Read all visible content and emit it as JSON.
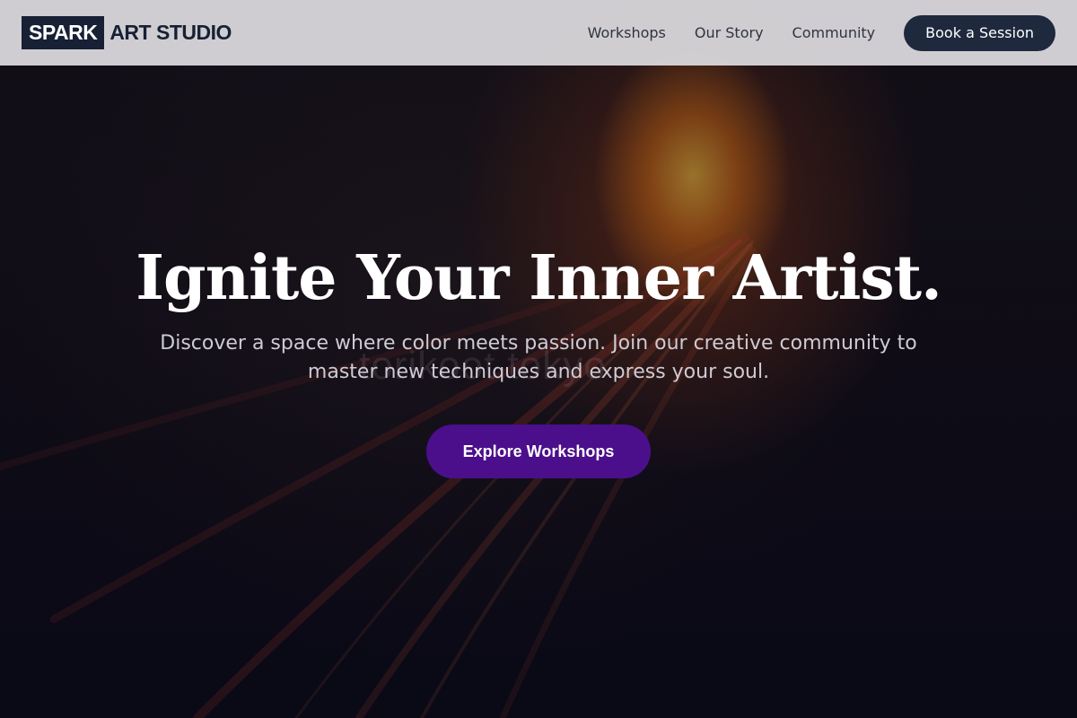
{
  "brand": {
    "logo_box": "SPARK",
    "logo_text": "ART STUDIO"
  },
  "nav": {
    "links": [
      "Workshops",
      "Our Story",
      "Community"
    ],
    "cta_label": "Book a Session"
  },
  "hero": {
    "headline": "Ignite Your Inner Artist.",
    "subheadline": "Discover a space where color meets passion. Join our creative community to master new techniques and express your soul.",
    "cta_label": "Explore Workshops"
  },
  "colors": {
    "nav_bg": "#d6d4d8",
    "brand_dark": "#172034",
    "nav_cta_bg": "#1e293d",
    "hero_cta_bg": "#4b0f8c",
    "headline_text": "#ffffff",
    "subheadline_text": "#cfcbd4"
  }
}
